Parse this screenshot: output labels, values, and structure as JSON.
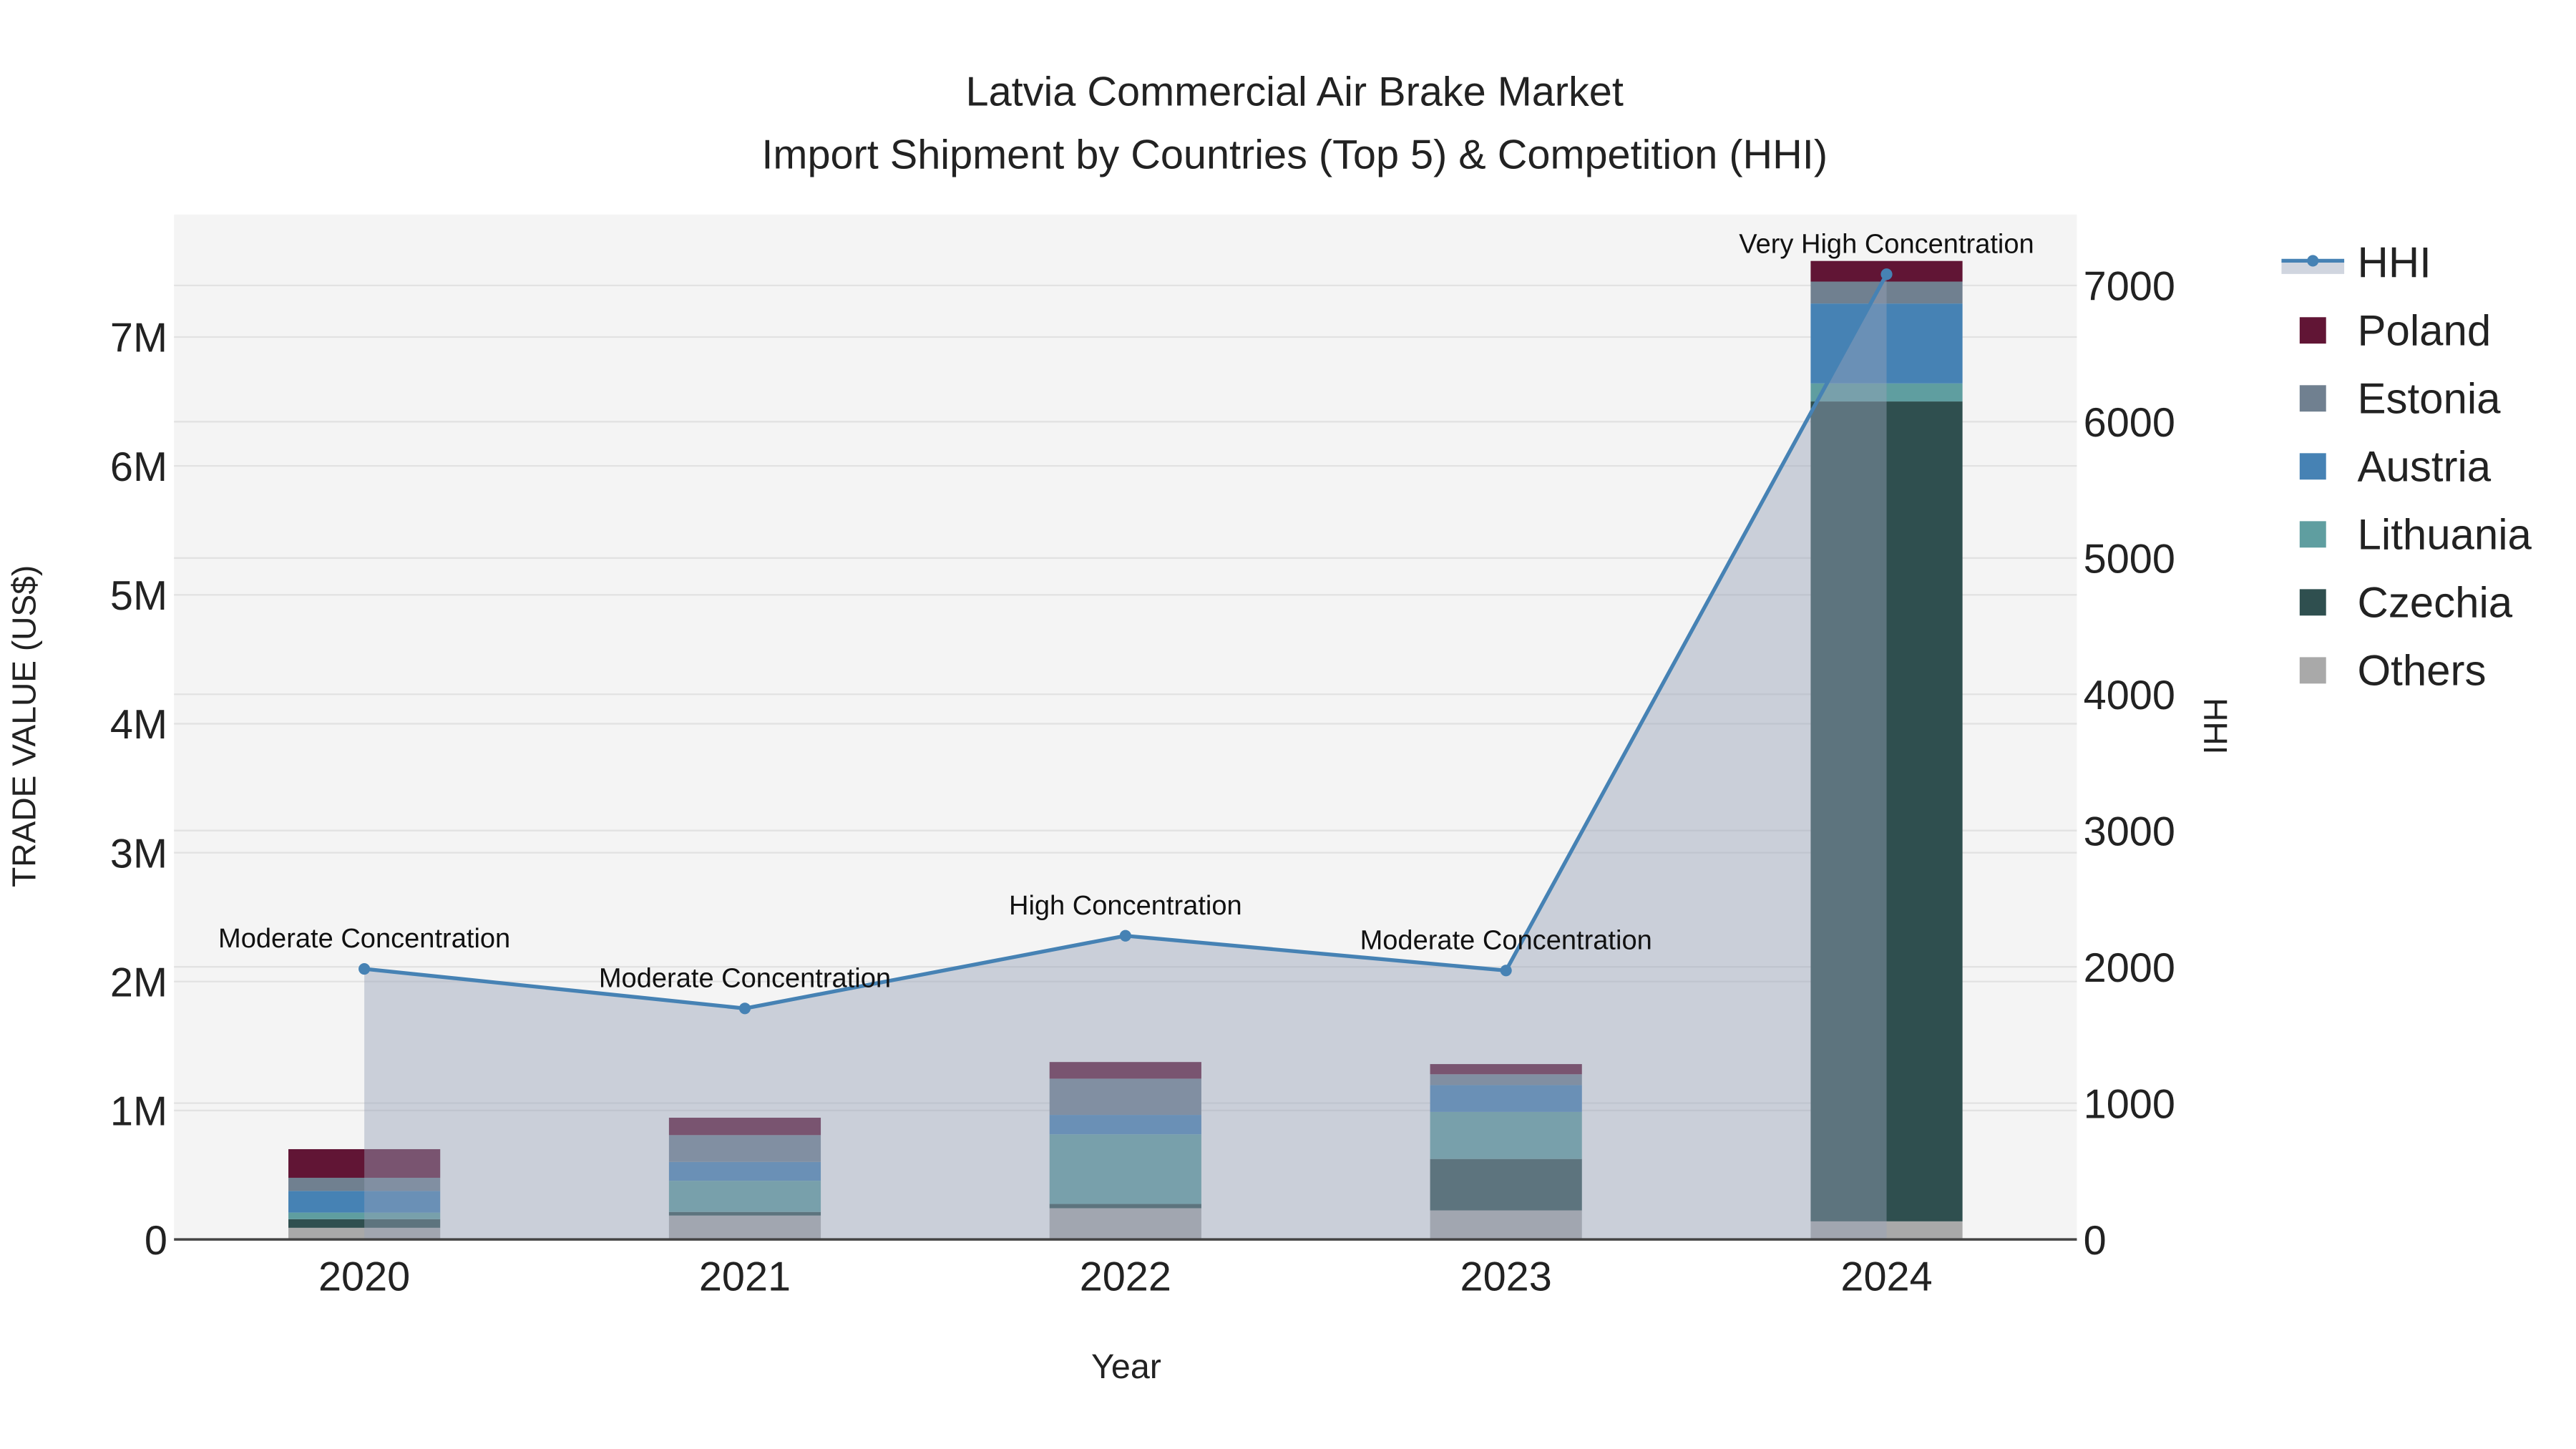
{
  "chart_data": {
    "type": "bar",
    "stacked": true,
    "title": "Latvia Commercial Air Brake Market",
    "subtitle": "Import Shipment by Countries (Top 5) & Competition (HHI)",
    "xlabel": "Year",
    "ylabel": "TRADE VALUE (US$)",
    "y2label": "HHI",
    "categories": [
      "2020",
      "2021",
      "2022",
      "2023",
      "2024"
    ],
    "ylim": [
      0,
      7.95
    ],
    "y_unit": "M",
    "yticks": [
      "0",
      "1M",
      "2M",
      "3M",
      "4M",
      "5M",
      "6M",
      "7M"
    ],
    "y2lim": [
      0,
      7520
    ],
    "y2ticks": [
      "0",
      "1000",
      "2000",
      "3000",
      "4000",
      "5000",
      "6000",
      "7000"
    ],
    "grid": true,
    "legend_position": "right",
    "series": [
      {
        "name": "Others",
        "color": "#A9A9A9",
        "values": [
          0.09,
          0.185,
          0.242,
          0.225,
          0.14
        ]
      },
      {
        "name": "Czechia",
        "color": "#2F4F4F",
        "values": [
          0.067,
          0.028,
          0.033,
          0.399,
          6.36
        ]
      },
      {
        "name": "Lithuania",
        "color": "#5F9EA0",
        "values": [
          0.051,
          0.242,
          0.54,
          0.365,
          0.14
        ]
      },
      {
        "name": "Austria",
        "color": "#4682B4",
        "values": [
          0.168,
          0.146,
          0.151,
          0.208,
          0.62
        ]
      },
      {
        "name": "Estonia",
        "color": "#708090",
        "values": [
          0.102,
          0.208,
          0.281,
          0.084,
          0.17
        ]
      },
      {
        "name": "Poland",
        "color": "#611535",
        "values": [
          0.222,
          0.135,
          0.129,
          0.079,
          0.16
        ]
      }
    ],
    "legend_order": [
      "HHI",
      "Poland",
      "Estonia",
      "Austria",
      "Lithuania",
      "Czechia",
      "Others"
    ],
    "line": {
      "name": "HHI",
      "color": "#4682B4",
      "values": [
        1985,
        1695,
        2228,
        1973,
        7082
      ],
      "annotations": [
        "Moderate Concentration",
        "Moderate Concentration",
        "High Concentration",
        "Moderate Concentration",
        "Very High Concentration"
      ]
    }
  }
}
